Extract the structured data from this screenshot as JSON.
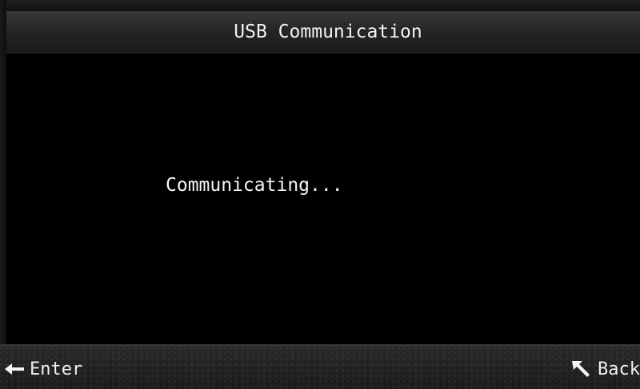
{
  "screen": {
    "title": "USB Communication",
    "status_message": "Communicating..."
  },
  "softkeys": {
    "enter": {
      "label": "Enter",
      "icon": "arrow-left-icon"
    },
    "back": {
      "label": "Back",
      "icon": "arrow-up-left-icon"
    }
  },
  "colors": {
    "background": "#000000",
    "text": "#f5f5f5",
    "title_bar": "#2a2a2a",
    "bottom_bar": "#232323"
  }
}
